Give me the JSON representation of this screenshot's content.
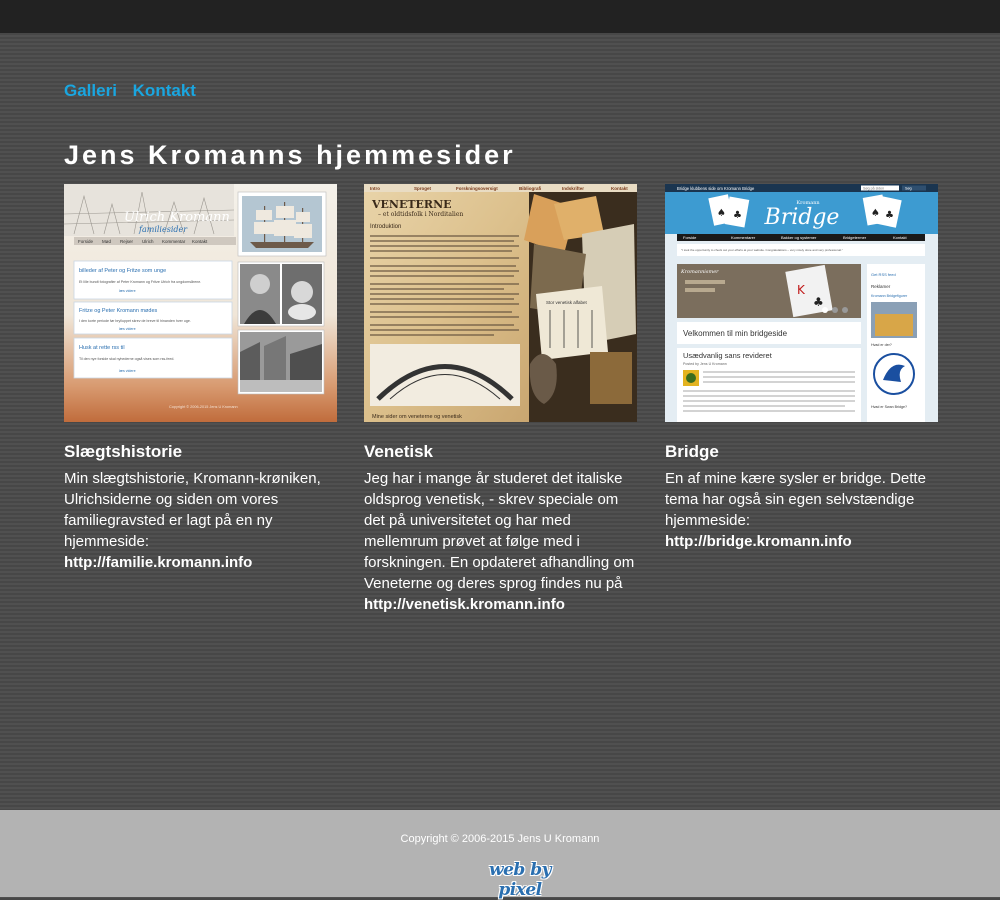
{
  "nav": {
    "items": [
      {
        "label": "Galleri"
      },
      {
        "label": "Kontakt"
      }
    ]
  },
  "page_title": "Jens Kromanns hjemmesider",
  "cards": [
    {
      "title": "Slægtshistorie",
      "text": "Min slægtshistorie, Kromann-krøniken, Ulrichsiderne og siden om vores familiegravsted er lagt på en ny hjemmeside: ",
      "link": "http://familie.kromann.info"
    },
    {
      "title": "Venetisk",
      "text": "Jeg har i mange år studeret det italiske oldsprog venetisk, - skrev speciale om det på universitetet og har med mellemrum prøvet at følge med i forskningen. En opdateret afhandling om Veneterne og deres sprog findes nu på ",
      "link": "http://venetisk.kromann.info"
    },
    {
      "title": "Bridge",
      "text": "En af mine kære sysler er bridge. Dette tema har også sin egen selvstændige hjemmeside: ",
      "link": "http://bridge.kromann.info"
    }
  ],
  "thumb1": {
    "site_name": "Ulrich Kromann",
    "tag": "familiesider",
    "menu": [
      "Forside",
      "Mød",
      "Rejser",
      "Ulrich",
      "Kommentar",
      "Kontakt"
    ],
    "boxes": [
      {
        "title": "billeder af Peter og Fritze som unge",
        "body": "Et lille bundt fotografier af Peter Kromann og Fritze Ulrich fra ungdomsårene.",
        "more": "læs videre"
      },
      {
        "title": "Fritze og Peter Kromann mødes",
        "body": "I den korte periode før brylluppet skrev de breve til hinanden hver uge.",
        "more": "læs videre"
      },
      {
        "title": "Husk at rette rss til",
        "body": "Til den nye forside skal nyhederne også vises som rss-feed.",
        "more": "læs videre"
      }
    ],
    "footer": "Copyright © 2006-2015 Jens U Kromann"
  },
  "thumb2": {
    "menu": [
      "Intro",
      "Sproget",
      "Forskningsoversigt",
      "Bibliografi",
      "Indskrifter",
      "Kontakt"
    ],
    "heading": "VENETERNE",
    "subheading": "– et oldtidsfolk i Norditalien",
    "section": "Introduktion",
    "caption": "Stor venetisk alfabet",
    "bottom": "Mine sider om veneterne og venetisk"
  },
  "thumb3": {
    "top_bar": "Bridge klubbens side om Kromann Bridge",
    "search": "Søg på siden",
    "search_btn": "Søg",
    "logo": "Bridge",
    "logo_small": "Kromann",
    "menu": [
      "Forside",
      "Kommentarer",
      "Bakker og systemer",
      "Bridgetermer",
      "Kontakt"
    ],
    "quote": "\"I took the opportunity to check out your efforts at your website. Congratulations – very nicely done and very professional.\"",
    "slider_title": "Kromannismer",
    "welcome": "Velkommen til min bridgeside",
    "post_title": "Usædvanlig sans revideret",
    "post_meta": "Posted by Jens U Kromann",
    "sidebar": [
      "Get RSS feed",
      "Reklamer",
      "Kromann Bridgefigurer",
      "Hvad er der?",
      "Hvad er Swan Bridge?"
    ]
  },
  "footer": {
    "copyright": "Copyright © 2006-2015 Jens U Kromann",
    "logo": "web by pixel"
  }
}
